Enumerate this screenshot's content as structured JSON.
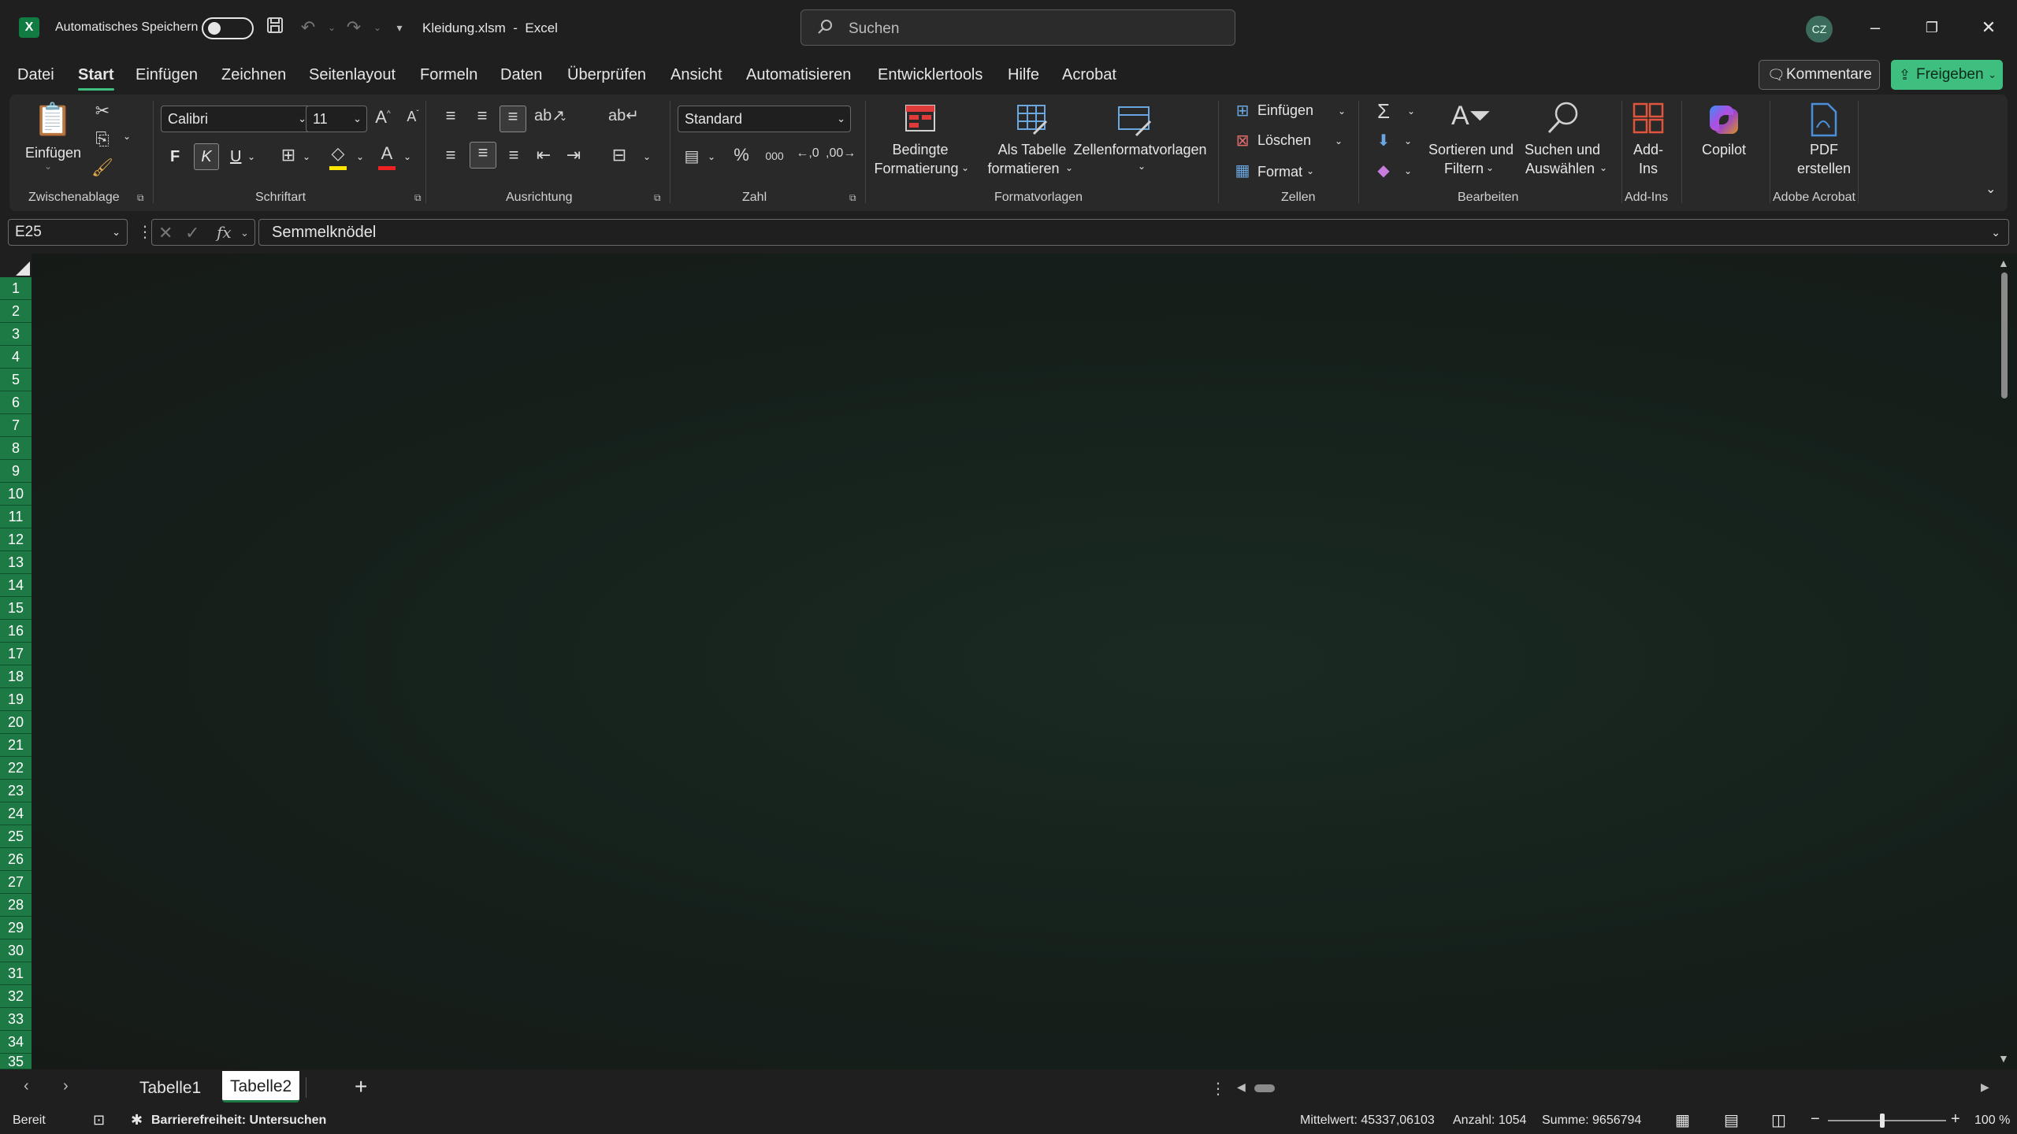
{
  "titlebar": {
    "autosave_label": "Automatisches Speichern",
    "document_title": "Kleidung.xlsm  -  Excel",
    "search_placeholder": "Suchen",
    "avatar_initials": "CZ"
  },
  "menu": {
    "tabs": [
      "Datei",
      "Start",
      "Einfügen",
      "Zeichnen",
      "Seitenlayout",
      "Formeln",
      "Daten",
      "Überprüfen",
      "Ansicht",
      "Automatisieren",
      "Entwicklertools",
      "Hilfe",
      "Acrobat"
    ],
    "active_tab": "Start",
    "comments_label": "Kommentare",
    "share_label": "Freigeben"
  },
  "ribbon": {
    "clipboard": {
      "paste_label": "Einfügen",
      "group_label": "Zwischenablage"
    },
    "font": {
      "font_name": "Calibri",
      "font_size": "11",
      "bold": "F",
      "italic": "K",
      "underline": "U",
      "group_label": "Schriftart"
    },
    "alignment": {
      "group_label": "Ausrichtung"
    },
    "number": {
      "format": "Standard",
      "group_label": "Zahl"
    },
    "styles": {
      "conditional_line1": "Bedingte",
      "conditional_line2": "Formatierung",
      "table_line1": "Als Tabelle",
      "table_line2": "formatieren",
      "cell_styles": "Zellenformatvorlagen",
      "group_label": "Formatvorlagen"
    },
    "cells": {
      "insert": "Einfügen",
      "delete": "Löschen",
      "format": "Format",
      "group_label": "Zellen"
    },
    "editing": {
      "sort_line1": "Sortieren und",
      "sort_line2": "Filtern",
      "find_line1": "Suchen und",
      "find_line2": "Auswählen",
      "group_label": "Bearbeiten"
    },
    "addins": {
      "line1": "Add-",
      "line2": "Ins",
      "group_label": "Add-Ins"
    },
    "copilot": {
      "label": "Copilot"
    },
    "acrobat": {
      "line1": "PDF",
      "line2": "erstellen",
      "group_label": "Adobe Acrobat"
    }
  },
  "formula_bar": {
    "name_box": "E25",
    "fx": "fx",
    "content": "Semmelknödel"
  },
  "grid": {
    "rows": [
      "1",
      "2",
      "3",
      "4",
      "5",
      "6",
      "7",
      "8",
      "9",
      "10",
      "11",
      "12",
      "13",
      "14",
      "15",
      "16",
      "17",
      "18",
      "19",
      "20",
      "21",
      "22",
      "23",
      "24",
      "25",
      "26",
      "27",
      "28",
      "29",
      "30",
      "31",
      "32",
      "33",
      "34",
      "35"
    ]
  },
  "sheets": {
    "tabs": [
      "Tabelle1",
      "Tabelle2"
    ],
    "active": "Tabelle2"
  },
  "statusbar": {
    "ready": "Bereit",
    "accessibility": "Barrierefreiheit: Untersuchen",
    "average": "Mittelwert: 45337,06103",
    "count": "Anzahl: 1054",
    "sum": "Summe: 9656794",
    "zoom": "100 %"
  },
  "colors": {
    "accent": "#3fbf7f",
    "row_header": "#1d7a45",
    "background": "#1f1f1f"
  }
}
